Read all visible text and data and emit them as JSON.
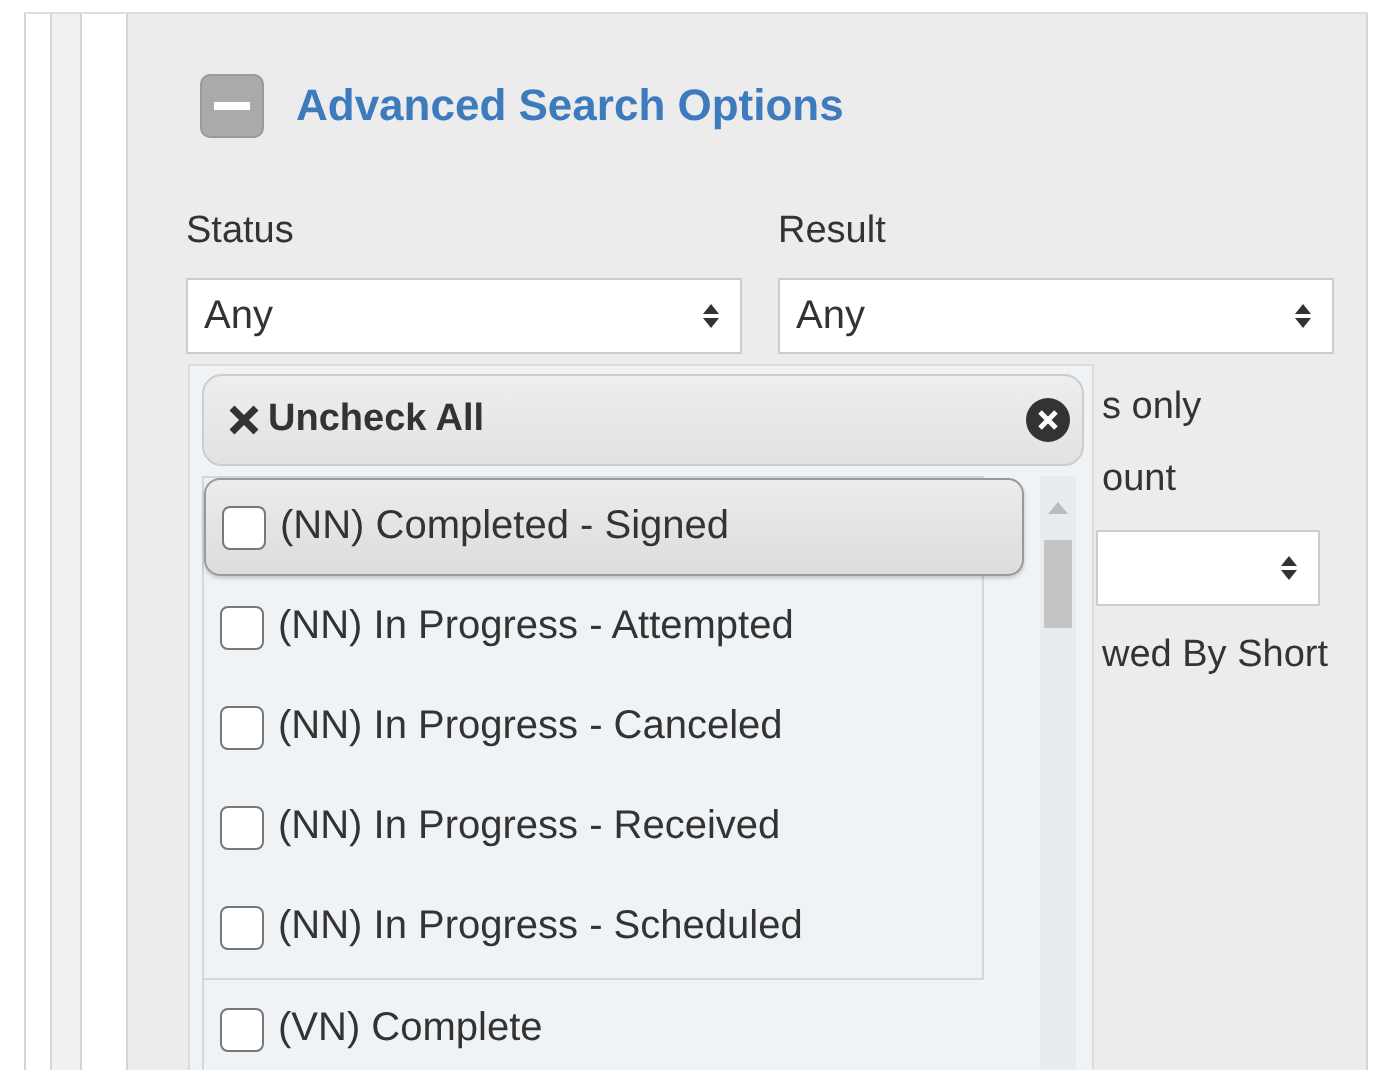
{
  "section": {
    "title": "Advanced Search Options",
    "expanded": true
  },
  "fields": [
    {
      "label": "Status",
      "value": "Any"
    },
    {
      "label": "Result",
      "value": "Any"
    }
  ],
  "covered_fields": [
    {
      "kind": "text",
      "text": "s only"
    },
    {
      "kind": "label",
      "text": "ount"
    },
    {
      "kind": "select"
    },
    {
      "kind": "text",
      "text": "wed By Short"
    }
  ],
  "status_menu": {
    "clear_button": "Uncheck All",
    "groups": [
      {
        "options": [
          {
            "label": "(NN) Completed - Signed",
            "checked": false,
            "selected": true
          },
          {
            "label": "(NN) In Progress - Attempted",
            "checked": false,
            "selected": false
          },
          {
            "label": "(NN) In Progress - Canceled",
            "checked": false,
            "selected": false
          },
          {
            "label": "(NN) In Progress - Received",
            "checked": false,
            "selected": false
          },
          {
            "label": "(NN) In Progress - Scheduled",
            "checked": false,
            "selected": false
          }
        ]
      },
      {
        "options": [
          {
            "label": "(VN) Complete",
            "checked": false,
            "selected": false
          }
        ]
      }
    ]
  }
}
